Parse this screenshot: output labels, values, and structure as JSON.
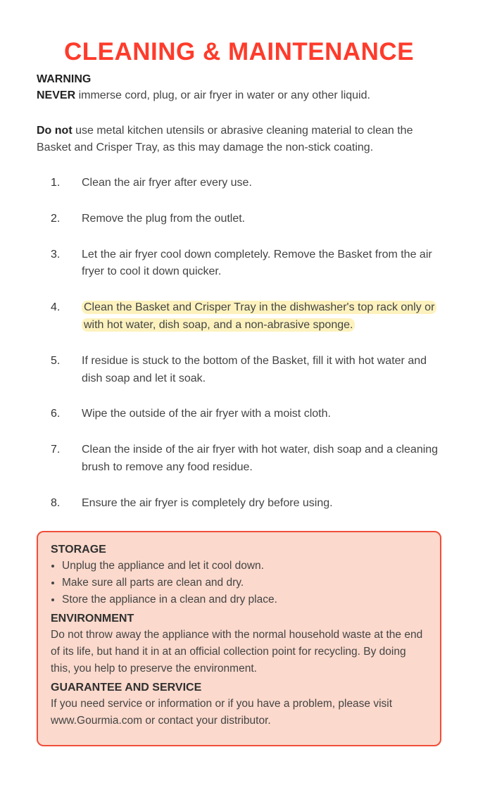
{
  "title": "CLEANING & MAINTENANCE",
  "warningHead": "WARNING",
  "warningBold": "NEVER",
  "warningText": " immerse cord, plug, or air fryer in water or any other liquid.",
  "doNotBold": "Do not",
  "doNotText": " use metal kitchen utensils or abrasive cleaning material to clean the Basket and Crisper Tray, as this may damage the non-stick coating.",
  "steps": [
    "Clean the air fryer after every use.",
    "Remove the plug from the outlet.",
    "Let the air fryer cool down completely. Remove the Basket from the air fryer to cool it down quicker.",
    "Clean the Basket and Crisper Tray in the dishwasher's top rack only or with hot water, dish soap, and a non-abrasive sponge.",
    "If residue is stuck to the bottom of the Basket, fill it with hot water and dish soap and let it soak.",
    "Wipe the outside of the air fryer with a moist cloth.",
    "Clean the inside of the air fryer with hot water, dish soap and a cleaning brush to remove any food residue.",
    "Ensure the air fryer is completely dry before using."
  ],
  "highlightIndex": 3,
  "box": {
    "storageHead": "STORAGE",
    "storageItems": [
      "Unplug the appliance and let it cool down.",
      "Make sure all parts are clean and dry.",
      "Store the appliance in a clean and dry place."
    ],
    "envHead": "ENVIRONMENT",
    "envText": "Do not throw away the appliance with the normal household waste at the end of its life, but hand it in at an official collection point for recycling. By doing this, you help to preserve the environment.",
    "guaranteeHead": "GUARANTEE AND SERVICE",
    "guaranteeText": "If you need service or information or if you have a problem, please visit www.Gourmia.com or contact your distributor."
  }
}
